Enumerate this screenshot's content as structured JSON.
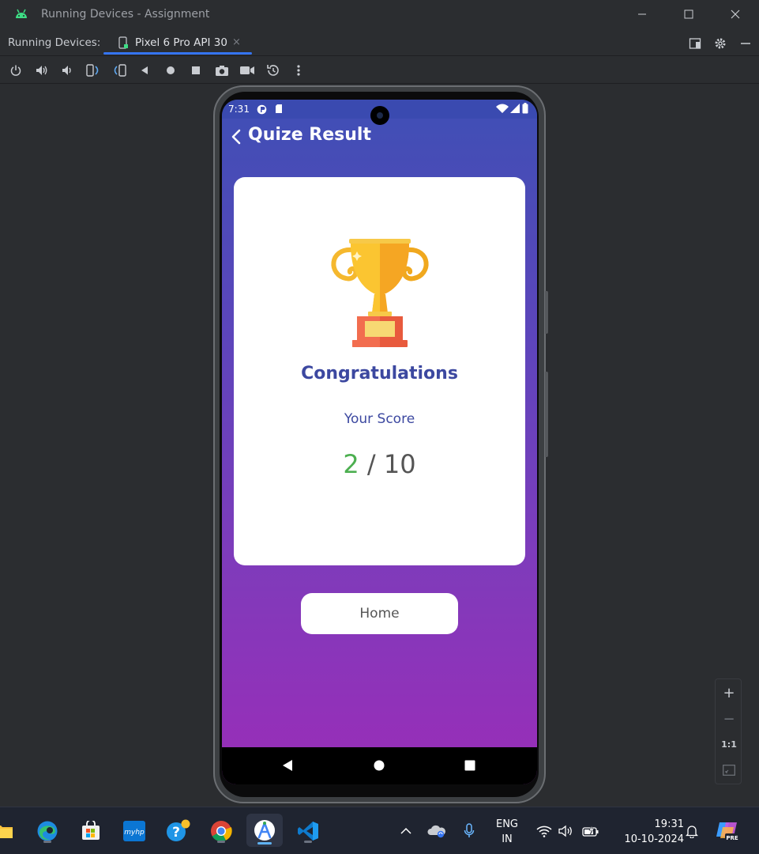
{
  "window": {
    "title": "Running Devices - Assignment"
  },
  "tabbar": {
    "label": "Running Devices:",
    "tab_label": "Pixel 6 Pro API 30",
    "tab_close": "×"
  },
  "toolbar": {
    "icons": [
      "power-icon",
      "volume-up-icon",
      "volume-down-icon",
      "rotate-left-icon",
      "rotate-right-icon",
      "back-icon",
      "home-icon",
      "overview-icon",
      "screenshot-icon",
      "screen-record-icon",
      "snapshot-icon",
      "more-options-icon"
    ]
  },
  "device": {
    "status_time": "7:31",
    "app_title": "Quize Result",
    "congrats": "Congratulations",
    "score_label": "Your Score",
    "score_value": "2",
    "score_separator": " / ",
    "score_total": "10",
    "home_button": "Home",
    "colors": {
      "gradient_top": "#3f4fb5",
      "gradient_bottom": "#9a2db8",
      "title_text": "#3c48a0",
      "score_value": "#4caf50"
    }
  },
  "zoom": {
    "zoom_in": "+",
    "zoom_out": "−",
    "actual_size": "1:1"
  },
  "taskbar": {
    "lang_line1": "ENG",
    "lang_line2": "IN",
    "time": "19:31",
    "date": "10-10-2024",
    "apps": [
      "file-explorer",
      "edge",
      "microsoft-store",
      "myhp",
      "get-help",
      "chrome",
      "android-studio",
      "vscode"
    ]
  }
}
